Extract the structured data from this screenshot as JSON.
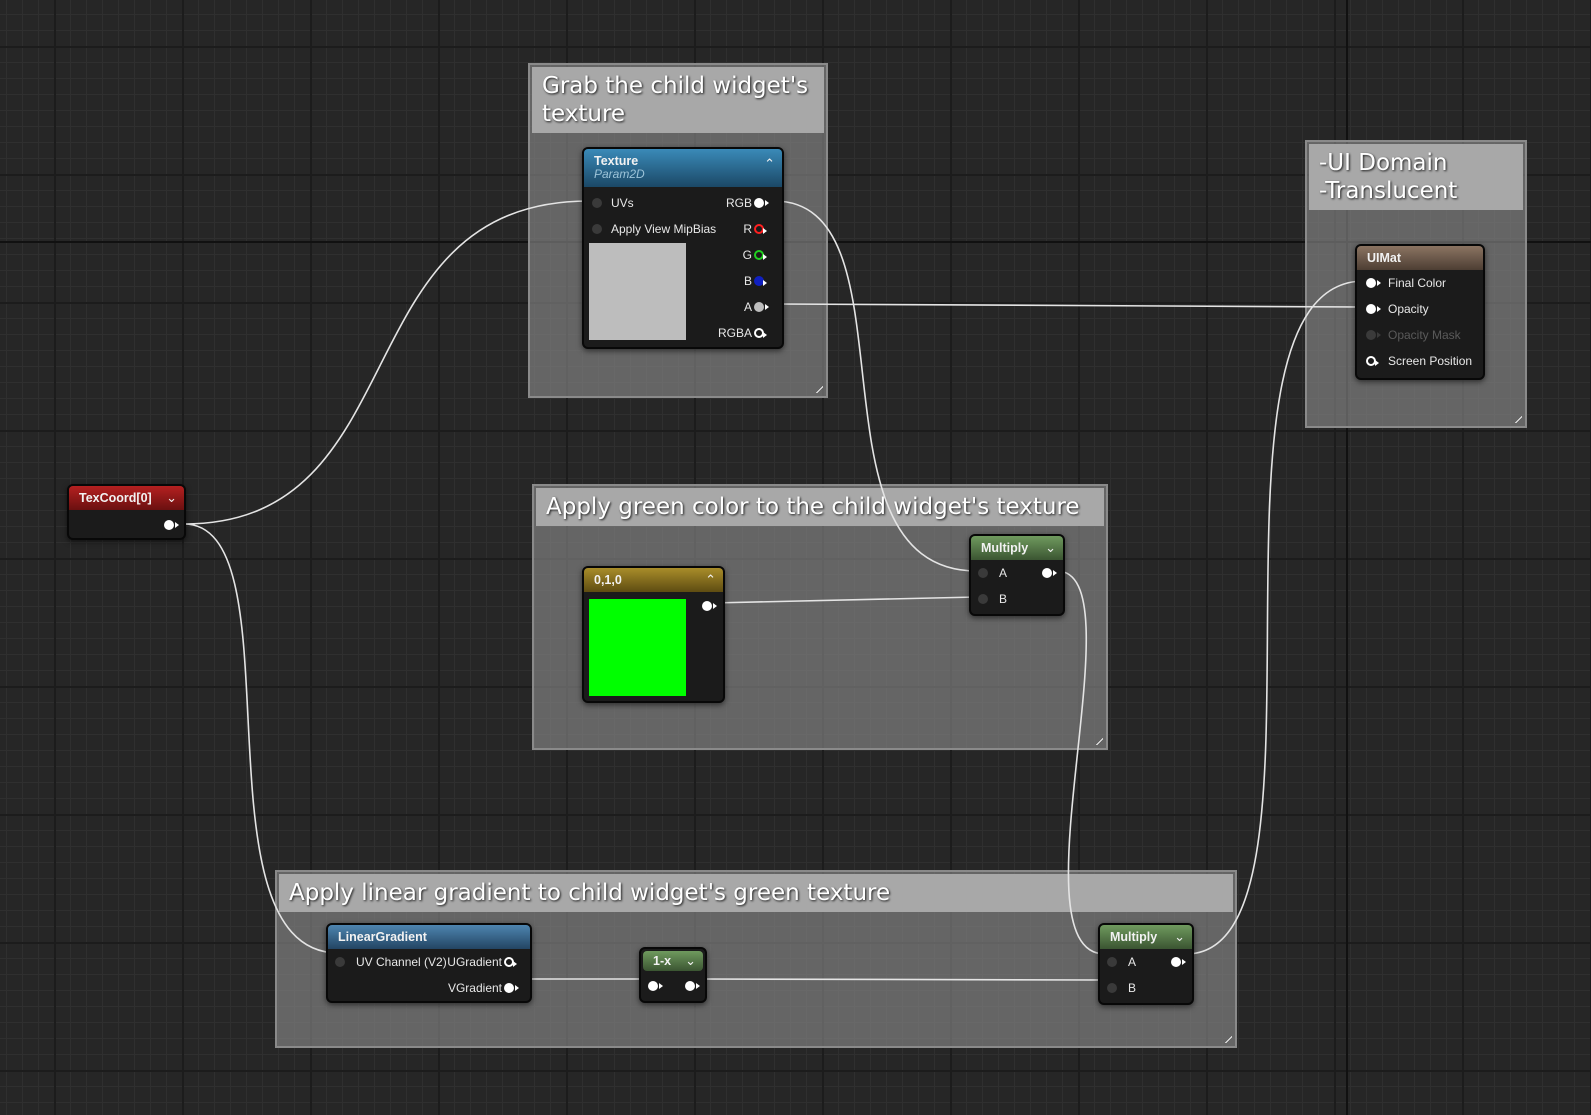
{
  "comments": {
    "grab": "Grab the child widget's texture",
    "green": "Apply green color to the child widget's texture",
    "linear": "Apply linear gradient to child widget's green texture",
    "ui": "-UI Domain\n-Translucent"
  },
  "texcoord": {
    "title": "TexCoord[0]"
  },
  "texture": {
    "title": "Texture",
    "subtitle": "Param2D",
    "inputs": [
      "UVs",
      "Apply View MipBias"
    ],
    "outputs": [
      "RGB",
      "R",
      "G",
      "B",
      "A",
      "RGBA"
    ]
  },
  "const3": {
    "title": "0,1,0",
    "swatch_color": "#00ff00"
  },
  "multiply1": {
    "title": "Multiply",
    "a": "A",
    "b": "B"
  },
  "linear_gradient": {
    "title": "LinearGradient",
    "input": "UV Channel (V2)",
    "outputs": [
      "UGradient",
      "VGradient"
    ]
  },
  "oneminus": {
    "title": "1-x"
  },
  "multiply2": {
    "title": "Multiply",
    "a": "A",
    "b": "B"
  },
  "uimat": {
    "title": "UIMat",
    "inputs": [
      "Final Color",
      "Opacity",
      "Opacity Mask",
      "Screen Position"
    ]
  },
  "colors": {
    "texture_header": "#2a6f94",
    "texcoord_header": "#8c1414",
    "const_header": "#8b7420",
    "math_header": "#5a7d4c",
    "function_header": "#3d6a8e",
    "result_header": "#6e5a4c",
    "pin_r": "#ff2020",
    "pin_g": "#20d020",
    "pin_b": "#1020c0"
  }
}
